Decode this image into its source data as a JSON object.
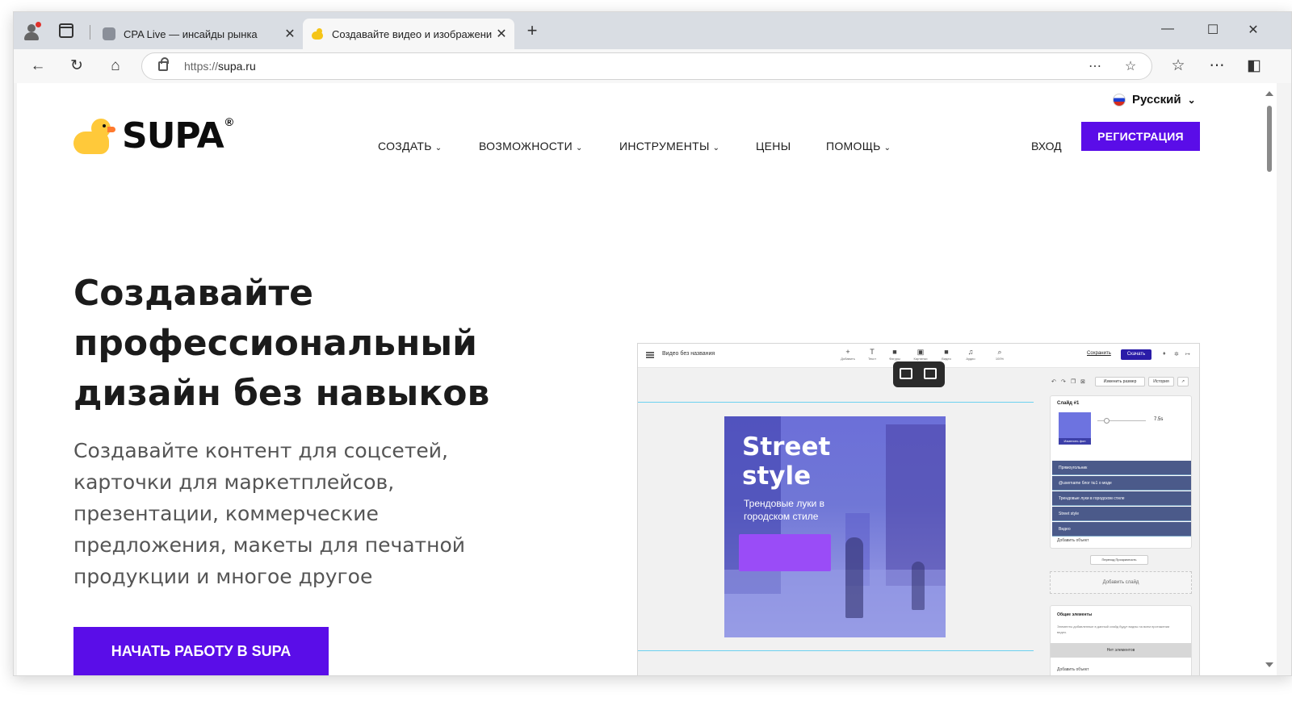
{
  "browser": {
    "tabs": [
      {
        "title": "CPA Live — инсайды рынка",
        "close": "✕"
      },
      {
        "title": "Создавайте видео и изображения",
        "close": "✕"
      }
    ],
    "new_tab": "+",
    "window_controls": {
      "minimize": "—",
      "maximize": "☐",
      "close": "✕"
    },
    "nav": {
      "back": "←",
      "reload": "↻",
      "home": "⌂"
    },
    "url_scheme": "https://",
    "url_host": "supa.ru",
    "address_icons": {
      "reader": "⋯",
      "favorite": "☆"
    },
    "right_icons": {
      "favorites": "☆",
      "more": "⋯",
      "sidebar": "◧"
    }
  },
  "site": {
    "language": "Русский",
    "logo": {
      "text": "SUPA",
      "mark": "®"
    },
    "nav": [
      {
        "label": "СОЗДАТЬ",
        "chevron": "⌄"
      },
      {
        "label": "ВОЗМОЖНОСТИ",
        "chevron": "⌄"
      },
      {
        "label": "ИНСТРУМЕНТЫ",
        "chevron": "⌄"
      },
      {
        "label": "ЦЕНЫ",
        "chevron": ""
      },
      {
        "label": "ПОМОЩЬ",
        "chevron": "⌄"
      }
    ],
    "login": "ВХОД",
    "register": "РЕГИСТРАЦИЯ",
    "hero_title": "Создавайте профессиональный дизайн без навыков",
    "hero_subtitle": "Создавайте контент для соцсетей, карточки для маркетплейсов, презентации, коммерческие предложения, макеты для печатной продукции и многое другое",
    "cta": "НАЧАТЬ РАБОТУ В SUPA"
  },
  "editor": {
    "title": "Видео без названия",
    "tools": [
      {
        "icon": "+",
        "label": "Добавить"
      },
      {
        "icon": "T",
        "label": "Текст"
      },
      {
        "icon": "■",
        "label": "Фигуры"
      },
      {
        "icon": "▣",
        "label": "Картинки"
      },
      {
        "icon": "■",
        "label": "Видео"
      },
      {
        "icon": "♫",
        "label": "Аудио"
      },
      {
        "icon": "⌕",
        "label": "100%"
      }
    ],
    "save": "Сохранить",
    "download": "Скачать",
    "panel_buttons": {
      "resize": "Изменить размер",
      "history": "История"
    },
    "slide_label": "Слайд #1",
    "change_bg": "Изменить фон",
    "duration": "7.5s",
    "layers": [
      "Прямоугольник",
      "@username блог №1 о моде",
      "Трендовые луки в городском стиле",
      "Street style",
      "Видео"
    ],
    "add_object": "Добавить объект",
    "transition": "Переход  Прозрачность",
    "add_slide": "Добавить слайд",
    "common_title": "Общие элементы",
    "common_desc": "Элементы добавленные в данный слайд будут видны на всем протяжении видео.",
    "no_elements": "Нет элементов",
    "common_add": "Добавить объект",
    "artwork": {
      "title": "Street\nstyle",
      "subtitle": "Трендовые луки в\nгородском стиле"
    }
  },
  "colors": {
    "accent": "#5a0de8",
    "duck": "#ffc93a",
    "art": "#6c6fd8"
  }
}
